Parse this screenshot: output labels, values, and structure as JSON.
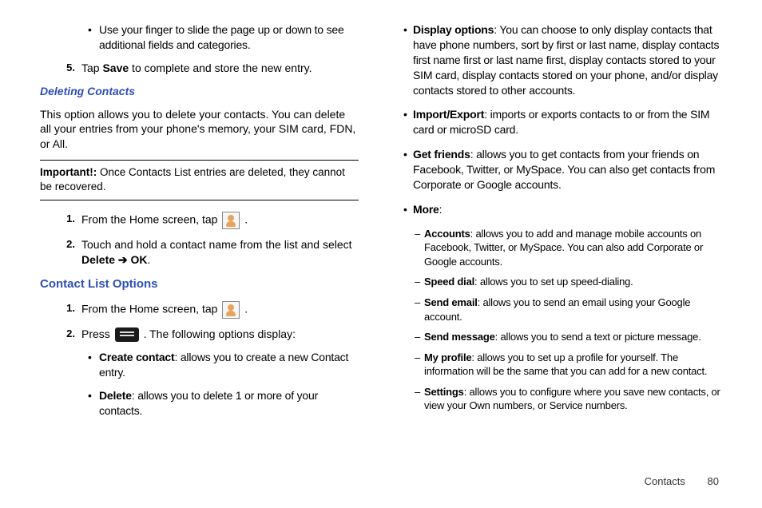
{
  "left": {
    "bullet1": "Use your finger to slide the page up or down to see additional fields and categories.",
    "step5_num": "5.",
    "step5_a": "Tap ",
    "step5_b": "Save",
    "step5_c": " to complete and store the new entry.",
    "heading_delete": "Deleting Contacts",
    "delete_para": "This option allows you to delete your contacts. You can delete all your entries from your phone's memory, your SIM card, FDN, or All.",
    "important_label": "Important!:",
    "important_text": " Once Contacts List entries are deleted, they cannot be recovered.",
    "d1_num": "1.",
    "d1_a": "From the Home screen, tap ",
    "d1_b": " .",
    "d2_num": "2.",
    "d2_a": "Touch and hold a contact name from the list and select ",
    "d2_b": "Delete",
    "d2_arrow": " ➔ ",
    "d2_c": "OK",
    "d2_d": ".",
    "heading_clo": "Contact List Options",
    "c1_num": "1.",
    "c1_a": "From the Home screen, tap ",
    "c1_b": " .",
    "c2_num": "2.",
    "c2_a": "Press ",
    "c2_b": ". The following options display:",
    "opt1_b": "Create contact",
    "opt1_t": ": allows you to create a new Contact entry.",
    "opt2_b": "Delete",
    "opt2_t": ": allows you to delete 1 or more of your contacts."
  },
  "right": {
    "opt3_b": "Display options",
    "opt3_t": ": You can choose to only display contacts that have phone numbers, sort by first or last name, display contacts first name first or last name first, display contacts stored to your SIM card, display contacts stored on your phone, and/or display contacts stored to other accounts.",
    "opt4_b": "Import/Export",
    "opt4_t": ": imports or exports contacts to or from the SIM card or microSD card.",
    "opt5_b": "Get friends",
    "opt5_t": ": allows you to get contacts from your friends on Facebook, Twitter, or MySpace. You can also get contacts from Corporate or Google accounts.",
    "opt6_b": "More",
    "opt6_t": ":",
    "m1_b": "Accounts",
    "m1_t": ": allows you to add and manage mobile accounts on Facebook, Twitter, or MySpace. You can also add Corporate or Google accounts.",
    "m2_b": "Speed dial",
    "m2_t": ": allows you to set up speed-dialing.",
    "m3_b": "Send email",
    "m3_t": ": allows you to send an email using your Google account.",
    "m4_b": "Send message",
    "m4_t": ": allows you to send a text or picture message.",
    "m5_b": "My profile",
    "m5_t": ": allows you to set up a profile for yourself. The information will be the same that you can add for a new contact.",
    "m6_b": "Settings",
    "m6_t": ": allows you to configure where you save new contacts, or view your Own numbers, or Service numbers."
  },
  "footer": {
    "section": "Contacts",
    "page": "80"
  }
}
